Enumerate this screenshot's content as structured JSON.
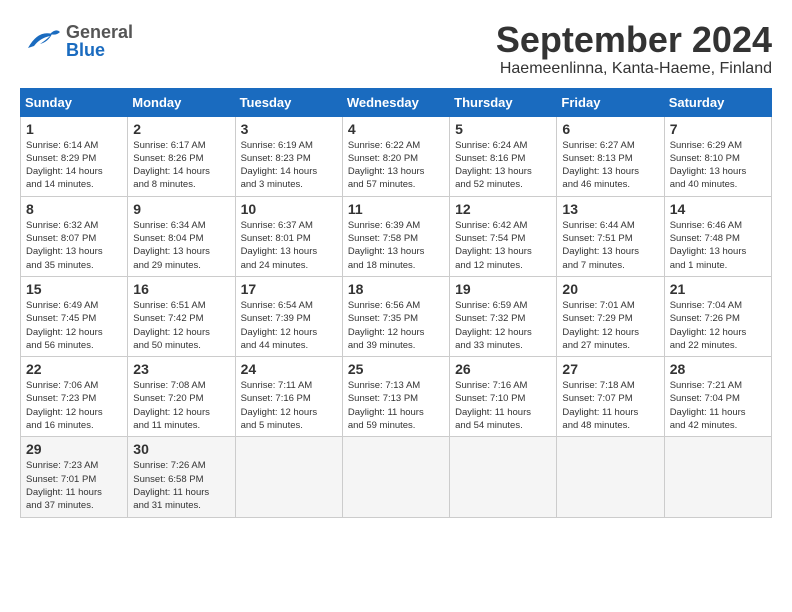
{
  "header": {
    "logo_general": "General",
    "logo_blue": "Blue",
    "month_title": "September 2024",
    "subtitle": "Haemeenlinna, Kanta-Haeme, Finland"
  },
  "calendar": {
    "days_of_week": [
      "Sunday",
      "Monday",
      "Tuesday",
      "Wednesday",
      "Thursday",
      "Friday",
      "Saturday"
    ],
    "weeks": [
      [
        {
          "day": "1",
          "info": "Sunrise: 6:14 AM\nSunset: 8:29 PM\nDaylight: 14 hours\nand 14 minutes."
        },
        {
          "day": "2",
          "info": "Sunrise: 6:17 AM\nSunset: 8:26 PM\nDaylight: 14 hours\nand 8 minutes."
        },
        {
          "day": "3",
          "info": "Sunrise: 6:19 AM\nSunset: 8:23 PM\nDaylight: 14 hours\nand 3 minutes."
        },
        {
          "day": "4",
          "info": "Sunrise: 6:22 AM\nSunset: 8:20 PM\nDaylight: 13 hours\nand 57 minutes."
        },
        {
          "day": "5",
          "info": "Sunrise: 6:24 AM\nSunset: 8:16 PM\nDaylight: 13 hours\nand 52 minutes."
        },
        {
          "day": "6",
          "info": "Sunrise: 6:27 AM\nSunset: 8:13 PM\nDaylight: 13 hours\nand 46 minutes."
        },
        {
          "day": "7",
          "info": "Sunrise: 6:29 AM\nSunset: 8:10 PM\nDaylight: 13 hours\nand 40 minutes."
        }
      ],
      [
        {
          "day": "8",
          "info": "Sunrise: 6:32 AM\nSunset: 8:07 PM\nDaylight: 13 hours\nand 35 minutes."
        },
        {
          "day": "9",
          "info": "Sunrise: 6:34 AM\nSunset: 8:04 PM\nDaylight: 13 hours\nand 29 minutes."
        },
        {
          "day": "10",
          "info": "Sunrise: 6:37 AM\nSunset: 8:01 PM\nDaylight: 13 hours\nand 24 minutes."
        },
        {
          "day": "11",
          "info": "Sunrise: 6:39 AM\nSunset: 7:58 PM\nDaylight: 13 hours\nand 18 minutes."
        },
        {
          "day": "12",
          "info": "Sunrise: 6:42 AM\nSunset: 7:54 PM\nDaylight: 13 hours\nand 12 minutes."
        },
        {
          "day": "13",
          "info": "Sunrise: 6:44 AM\nSunset: 7:51 PM\nDaylight: 13 hours\nand 7 minutes."
        },
        {
          "day": "14",
          "info": "Sunrise: 6:46 AM\nSunset: 7:48 PM\nDaylight: 13 hours\nand 1 minute."
        }
      ],
      [
        {
          "day": "15",
          "info": "Sunrise: 6:49 AM\nSunset: 7:45 PM\nDaylight: 12 hours\nand 56 minutes."
        },
        {
          "day": "16",
          "info": "Sunrise: 6:51 AM\nSunset: 7:42 PM\nDaylight: 12 hours\nand 50 minutes."
        },
        {
          "day": "17",
          "info": "Sunrise: 6:54 AM\nSunset: 7:39 PM\nDaylight: 12 hours\nand 44 minutes."
        },
        {
          "day": "18",
          "info": "Sunrise: 6:56 AM\nSunset: 7:35 PM\nDaylight: 12 hours\nand 39 minutes."
        },
        {
          "day": "19",
          "info": "Sunrise: 6:59 AM\nSunset: 7:32 PM\nDaylight: 12 hours\nand 33 minutes."
        },
        {
          "day": "20",
          "info": "Sunrise: 7:01 AM\nSunset: 7:29 PM\nDaylight: 12 hours\nand 27 minutes."
        },
        {
          "day": "21",
          "info": "Sunrise: 7:04 AM\nSunset: 7:26 PM\nDaylight: 12 hours\nand 22 minutes."
        }
      ],
      [
        {
          "day": "22",
          "info": "Sunrise: 7:06 AM\nSunset: 7:23 PM\nDaylight: 12 hours\nand 16 minutes."
        },
        {
          "day": "23",
          "info": "Sunrise: 7:08 AM\nSunset: 7:20 PM\nDaylight: 12 hours\nand 11 minutes."
        },
        {
          "day": "24",
          "info": "Sunrise: 7:11 AM\nSunset: 7:16 PM\nDaylight: 12 hours\nand 5 minutes."
        },
        {
          "day": "25",
          "info": "Sunrise: 7:13 AM\nSunset: 7:13 PM\nDaylight: 11 hours\nand 59 minutes."
        },
        {
          "day": "26",
          "info": "Sunrise: 7:16 AM\nSunset: 7:10 PM\nDaylight: 11 hours\nand 54 minutes."
        },
        {
          "day": "27",
          "info": "Sunrise: 7:18 AM\nSunset: 7:07 PM\nDaylight: 11 hours\nand 48 minutes."
        },
        {
          "day": "28",
          "info": "Sunrise: 7:21 AM\nSunset: 7:04 PM\nDaylight: 11 hours\nand 42 minutes."
        }
      ],
      [
        {
          "day": "29",
          "info": "Sunrise: 7:23 AM\nSunset: 7:01 PM\nDaylight: 11 hours\nand 37 minutes."
        },
        {
          "day": "30",
          "info": "Sunrise: 7:26 AM\nSunset: 6:58 PM\nDaylight: 11 hours\nand 31 minutes."
        },
        {
          "day": "",
          "info": ""
        },
        {
          "day": "",
          "info": ""
        },
        {
          "day": "",
          "info": ""
        },
        {
          "day": "",
          "info": ""
        },
        {
          "day": "",
          "info": ""
        }
      ]
    ]
  }
}
